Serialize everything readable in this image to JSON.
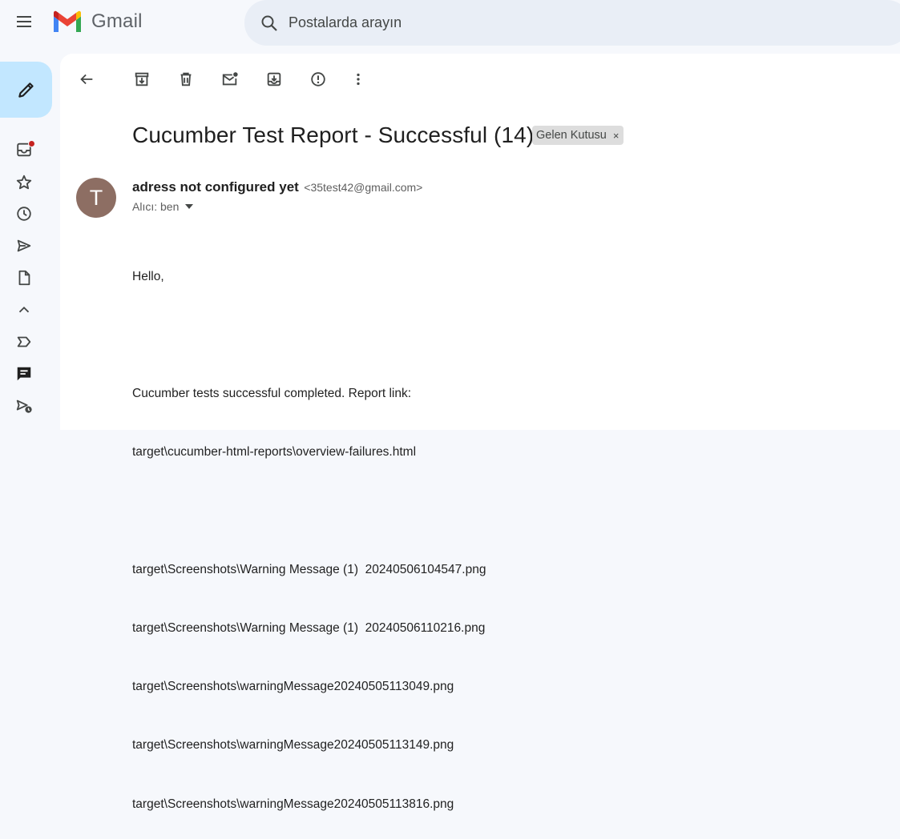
{
  "app": {
    "name": "Gmail"
  },
  "search": {
    "placeholder": "Postalarda arayın"
  },
  "email": {
    "subject": "Cucumber Test Report - Successful (14)",
    "label": "Gelen Kutusu",
    "label_remove": "×",
    "sender_initial": "T",
    "sender_name": "adress not configured yet",
    "sender_email": "<35test42@gmail.com>",
    "recipient": "Alıcı: ben",
    "body": [
      "Hello,",
      "",
      "Cucumber tests successful completed. Report link:",
      "target\\cucumber-html-reports\\overview-failures.html",
      "",
      "target\\Screenshots\\Warning Message (1)  20240506104547.png",
      "target\\Screenshots\\Warning Message (1)  20240506110216.png",
      "target\\Screenshots\\warningMessage20240505113049.png",
      "target\\Screenshots\\warningMessage20240505113149.png",
      "target\\Screenshots\\warningMessage20240505113816.png"
    ]
  },
  "toolbar": {
    "icons": [
      "back-icon",
      "archive-icon",
      "delete-icon",
      "mark-unread-icon",
      "move-to-icon",
      "report-spam-icon",
      "more-vert-icon"
    ]
  },
  "rail": {
    "icons": [
      "inbox-icon",
      "star-icon",
      "clock-icon",
      "send-icon",
      "file-icon",
      "chevron-up-icon",
      "label-important-icon",
      "chat-icon",
      "scheduled-send-icon"
    ]
  },
  "colors": {
    "background": "#f6f8fc",
    "search_bg": "#e9eef6",
    "compose_bg": "#c2e7ff",
    "avatar_bg": "#8d6e63",
    "unread_dot": "#c5221f",
    "label_chip_bg": "#dddddd"
  }
}
